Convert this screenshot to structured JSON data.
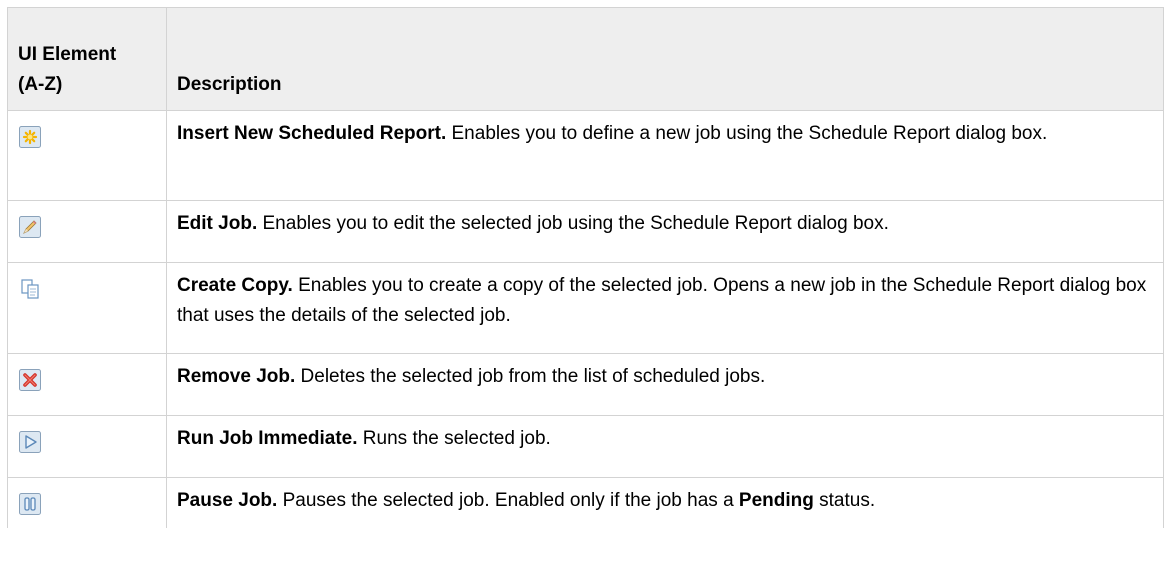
{
  "table": {
    "headers": {
      "ui_element": [
        "UI Element",
        "(A-Z)"
      ],
      "description": "Description"
    },
    "rows": [
      {
        "icon": "new-star-icon",
        "title": "Insert New Scheduled Report.",
        "text": " Enables you to define a new job using the Schedule Report dialog box."
      },
      {
        "icon": "pencil-icon",
        "title": "Edit Job.",
        "text": " Enables you to edit the selected job using the Schedule Report dialog box."
      },
      {
        "icon": "copy-icon",
        "title": "Create Copy.",
        "text": " Enables you to create a copy of the selected job. Opens a new job in the Schedule Report dialog box that uses the details of the selected job."
      },
      {
        "icon": "red-x-icon",
        "title": "Remove Job.",
        "text": " Deletes the selected job from the list of scheduled jobs."
      },
      {
        "icon": "play-icon",
        "title": "Run Job Immediate.",
        "text": " Runs the selected job."
      },
      {
        "icon": "pause-icon",
        "title": "Pause Job.",
        "text_before": " Pauses the selected job. Enabled only if the job has a ",
        "bold": "Pending",
        "text_after": " status."
      }
    ]
  }
}
